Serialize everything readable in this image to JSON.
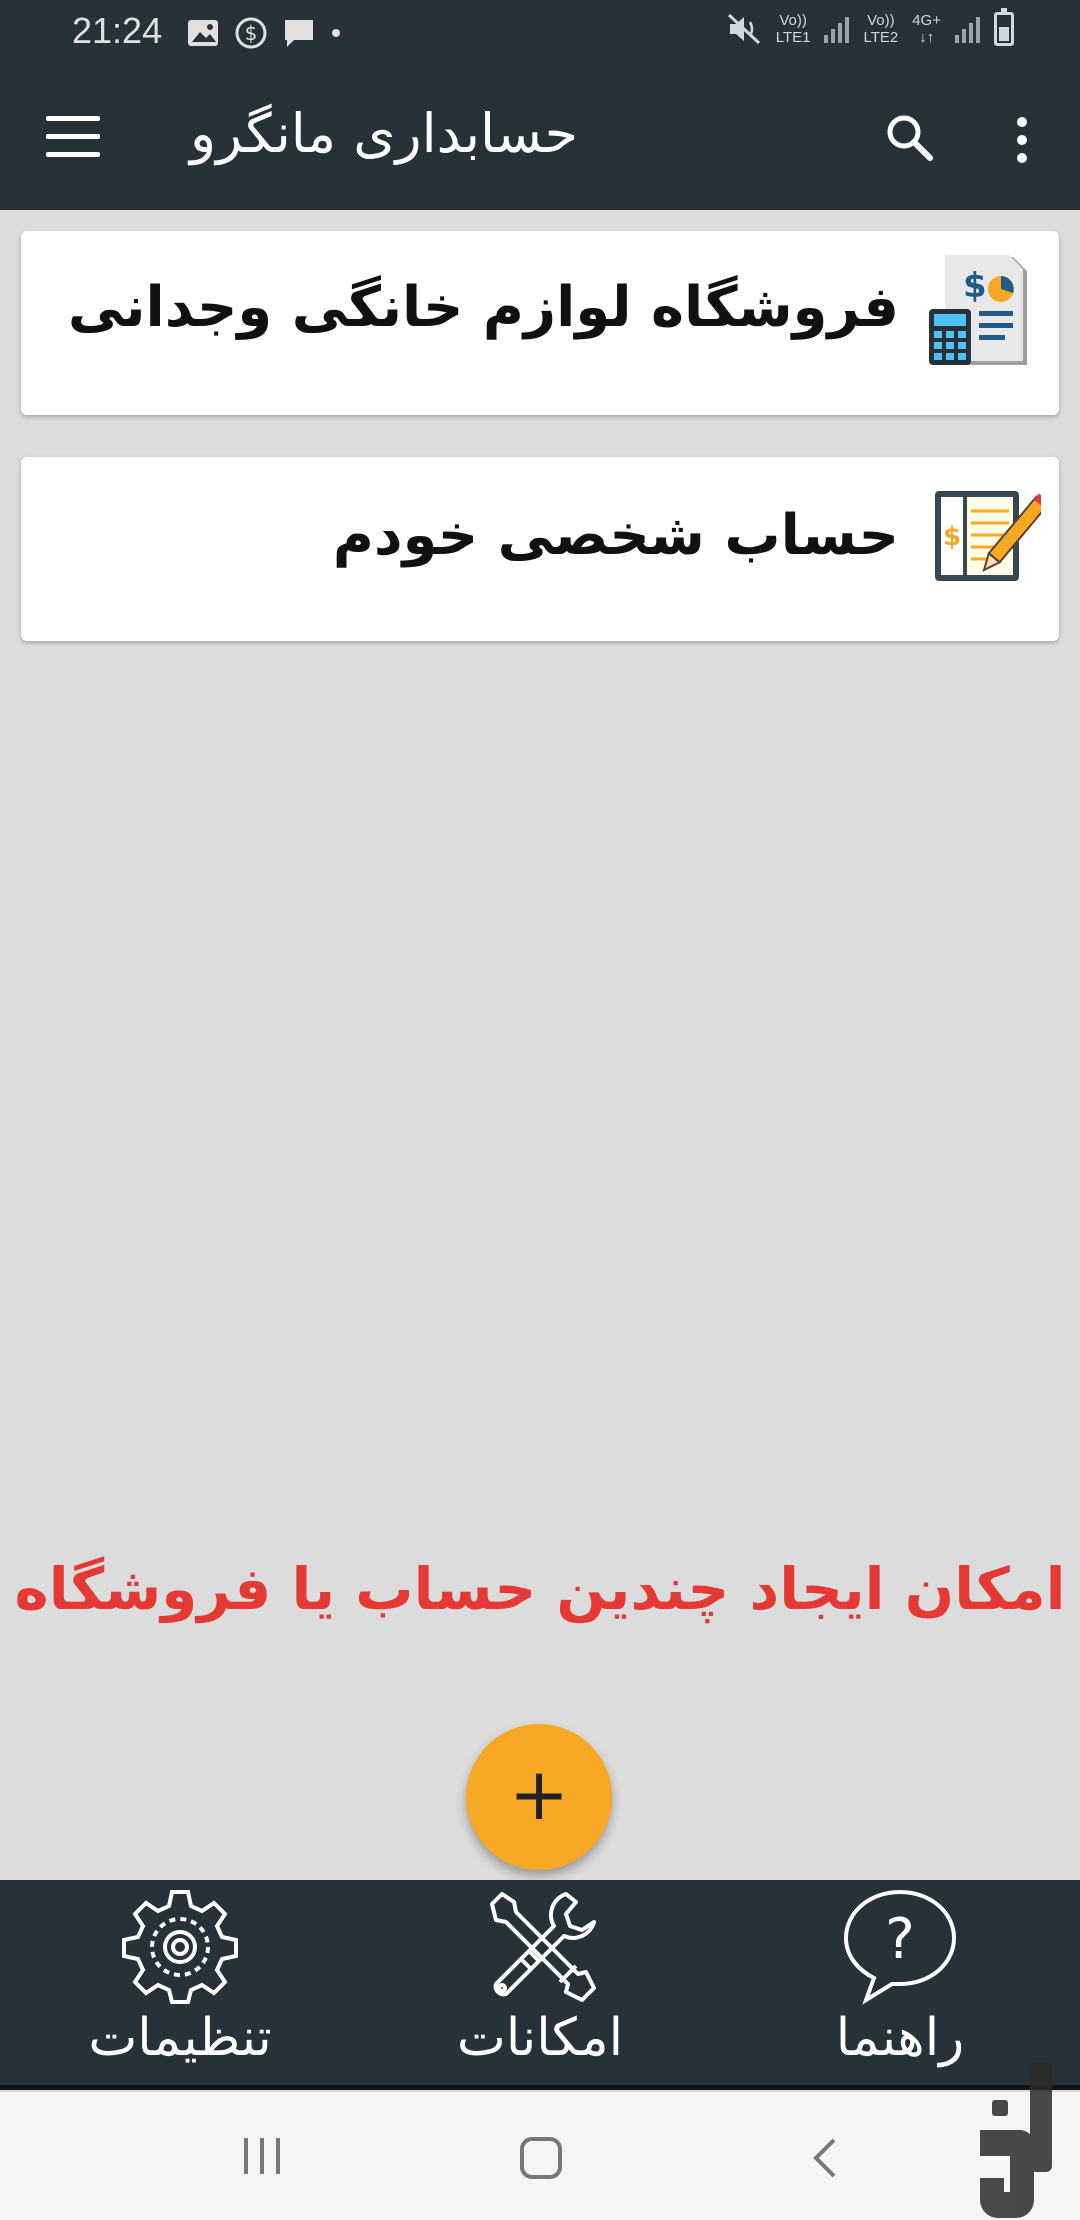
{
  "status_bar": {
    "time": "21:24",
    "sim1": {
      "top": "Vo))",
      "bottom": "LTE1"
    },
    "sim2": {
      "top": "Vo))",
      "bottom": "LTE2"
    },
    "network_type": "4G+"
  },
  "app_bar": {
    "title": "حسابداری مانگرو"
  },
  "accounts": [
    {
      "title": "فروشگاه لوازم خانگی وجدانی",
      "icon": "accounting-calculator-icon"
    },
    {
      "title": "حساب شخصی خودم",
      "icon": "ledger-pencil-icon"
    }
  ],
  "promo_text": "امکان ایجاد چندین حساب یا فروشگاه",
  "fab": {
    "label": "+"
  },
  "bottom_nav": {
    "settings": "تنظیمات",
    "features": "امکانات",
    "help": "راهنما"
  },
  "colors": {
    "bar": "#263238",
    "background": "#dcdcdc",
    "accent": "#f9a825",
    "promo": "#e53935"
  }
}
